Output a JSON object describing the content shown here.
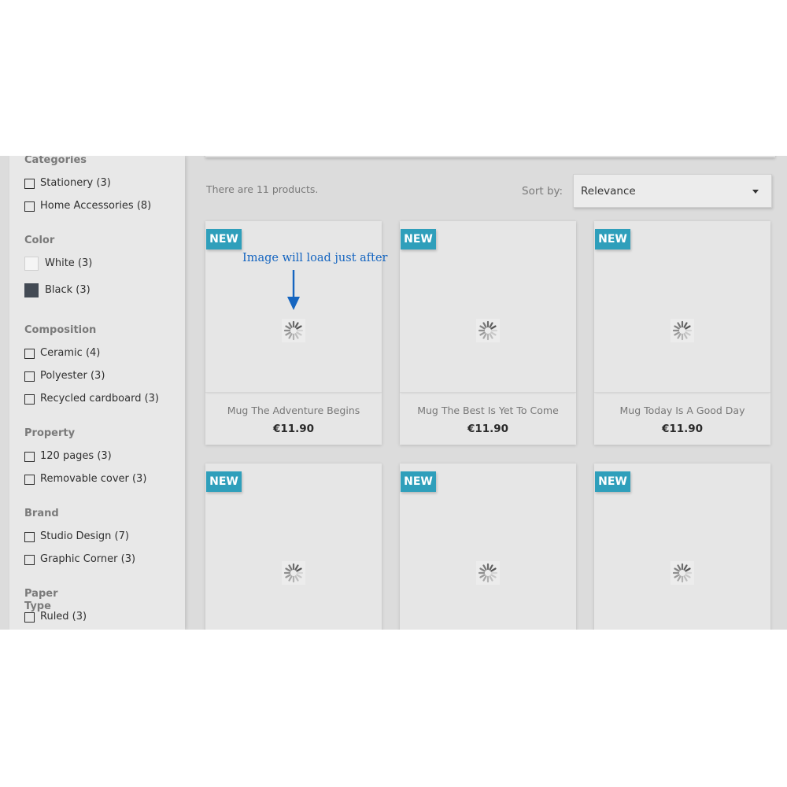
{
  "sidebar": {
    "facets": [
      {
        "title": "Categories",
        "items": [
          {
            "label": "Stationery (3)",
            "control": "checkbox"
          },
          {
            "label": "Home Accessories (8)",
            "control": "checkbox"
          }
        ]
      },
      {
        "title": "Color",
        "items": [
          {
            "label": "White (3)",
            "control": "swatch",
            "color": "#f5f5f5"
          },
          {
            "label": "Black (3)",
            "control": "swatch",
            "color": "#434a54"
          }
        ]
      },
      {
        "title": "Composition",
        "items": [
          {
            "label": "Ceramic (4)",
            "control": "checkbox"
          },
          {
            "label": "Polyester (3)",
            "control": "checkbox"
          },
          {
            "label": "Recycled cardboard (3)",
            "control": "checkbox"
          }
        ]
      },
      {
        "title": "Property",
        "items": [
          {
            "label": "120 pages (3)",
            "control": "checkbox"
          },
          {
            "label": "Removable cover (3)",
            "control": "checkbox"
          }
        ]
      },
      {
        "title": "Brand",
        "items": [
          {
            "label": "Studio Design (7)",
            "control": "checkbox"
          },
          {
            "label": "Graphic Corner (3)",
            "control": "checkbox"
          }
        ]
      },
      {
        "title": "Paper Type",
        "items": [
          {
            "label": "Ruled (3)",
            "control": "checkbox"
          }
        ]
      }
    ]
  },
  "main": {
    "product_count": "There are 11 products.",
    "sort_label": "Sort by:",
    "sort_value": "Relevance",
    "annotation": "Image will load just after"
  },
  "products": [
    {
      "badge": "NEW",
      "name": "Mug The Adventure Begins",
      "price": "€11.90"
    },
    {
      "badge": "NEW",
      "name": "Mug The Best Is Yet To Come",
      "price": "€11.90"
    },
    {
      "badge": "NEW",
      "name": "Mug Today Is A Good Day",
      "price": "€11.90"
    },
    {
      "badge": "NEW",
      "name": "",
      "price": ""
    },
    {
      "badge": "NEW",
      "name": "",
      "price": ""
    },
    {
      "badge": "NEW",
      "name": "",
      "price": ""
    }
  ],
  "colors": {
    "badge": "#2f9fbb",
    "annotation": "#1565c0",
    "spinner": "#555555"
  },
  "icons": {
    "sort_caret": "caret-down-icon",
    "loading": "spinner-icon",
    "annotation_arrow": "arrow-down-icon"
  }
}
